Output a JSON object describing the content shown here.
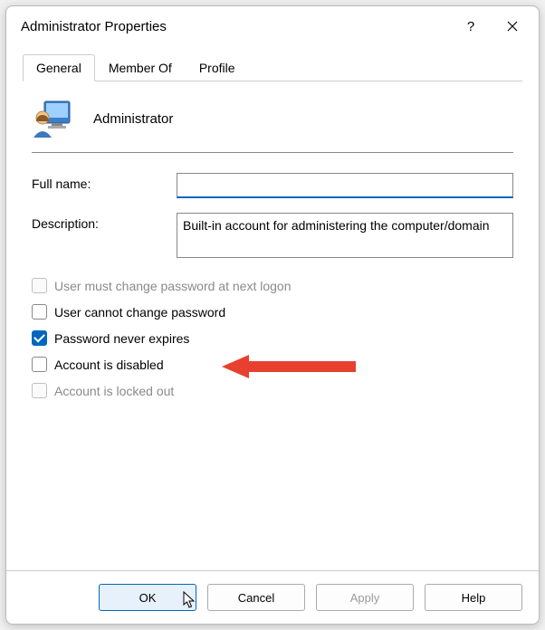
{
  "title": "Administrator Properties",
  "tabs": [
    {
      "label": "General",
      "active": true
    },
    {
      "label": "Member Of",
      "active": false
    },
    {
      "label": "Profile",
      "active": false
    }
  ],
  "account_name": "Administrator",
  "fields": {
    "full_name_label": "Full name:",
    "full_name_value": "",
    "description_label": "Description:",
    "description_value": "Built-in account for administering the computer/domain"
  },
  "checks": [
    {
      "label": "User must change password at next logon",
      "checked": false,
      "disabled": true
    },
    {
      "label": "User cannot change password",
      "checked": false,
      "disabled": false
    },
    {
      "label": "Password never expires",
      "checked": true,
      "disabled": false
    },
    {
      "label": "Account is disabled",
      "checked": false,
      "disabled": false
    },
    {
      "label": "Account is locked out",
      "checked": false,
      "disabled": true
    }
  ],
  "buttons": {
    "ok": "OK",
    "cancel": "Cancel",
    "apply": "Apply",
    "help": "Help"
  }
}
